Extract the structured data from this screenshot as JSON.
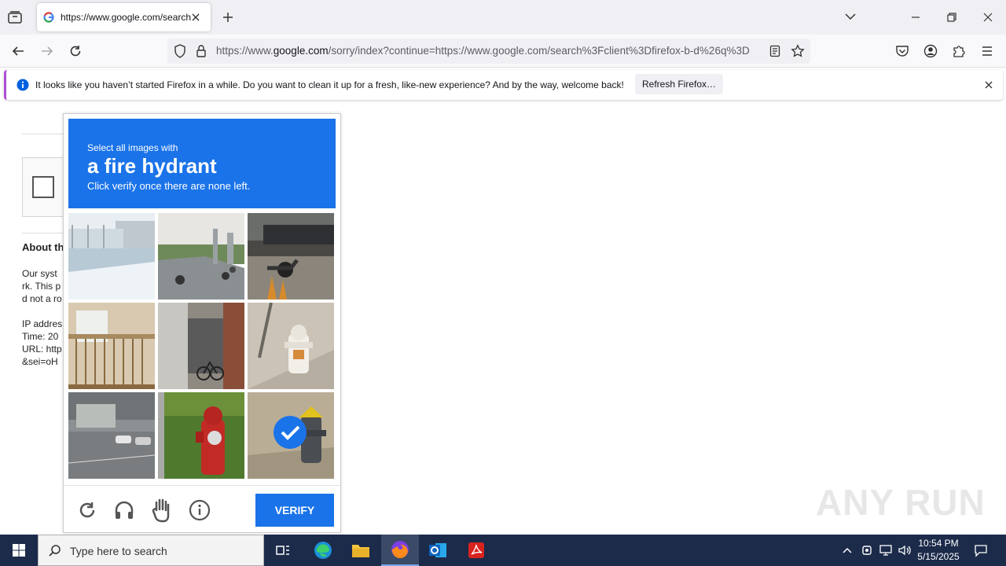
{
  "browser": {
    "tab_title": "https://www.google.com/search?",
    "url_prefix": "https://www.",
    "url_domain": "google.com",
    "url_rest": "/sorry/index?continue=https://www.google.com/search%3Fclient%3Dfirefox-b-d%26q%3D",
    "icons": [
      "tab-list-icon",
      "google-favicon",
      "close-tab-icon",
      "new-tab-icon",
      "chevron-down-icon",
      "minimize-icon",
      "restore-icon",
      "close-window-icon",
      "back-icon",
      "forward-icon",
      "reload-icon",
      "shield-icon",
      "lock-icon",
      "reader-view-icon",
      "star-icon",
      "pocket-icon",
      "account-icon",
      "extensions-icon",
      "menu-icon"
    ]
  },
  "notification": {
    "message": "It looks like you haven’t started Firefox in a while. Do you want to clean it up for a fresh, like-new experience? And by the way, welcome back!",
    "button_label": "Refresh Firefox…"
  },
  "page": {
    "about_heading": "About th",
    "lines": [
      "Our syst",
      "rk. This p",
      "d not a ro",
      "IP addres",
      "Time: 20",
      "URL: http",
      "&sei=oH"
    ]
  },
  "captcha": {
    "instruction": "Select all images with",
    "target": "a fire hydrant",
    "hint": "Click verify once there are none left.",
    "verify_label": "VERIFY",
    "tiles": [
      {
        "scene": "bus stop",
        "selected": false
      },
      {
        "scene": "motorcycles on road",
        "selected": false
      },
      {
        "scene": "motorcycle with cones",
        "selected": false
      },
      {
        "scene": "balcony",
        "selected": false
      },
      {
        "scene": "bicycle alley",
        "selected": false
      },
      {
        "scene": "white fire hydrant",
        "selected": false
      },
      {
        "scene": "parking lot",
        "selected": false
      },
      {
        "scene": "red fire hydrant",
        "selected": false
      },
      {
        "scene": "grey fire hydrant",
        "selected": true
      }
    ],
    "footer_icons": [
      "reload-icon",
      "headphones-icon",
      "hand-icon",
      "info-icon"
    ]
  },
  "taskbar": {
    "search_placeholder": "Type here to search",
    "time": "10:54 PM",
    "date": "5/15/2025"
  },
  "watermark": "ANY RUN"
}
